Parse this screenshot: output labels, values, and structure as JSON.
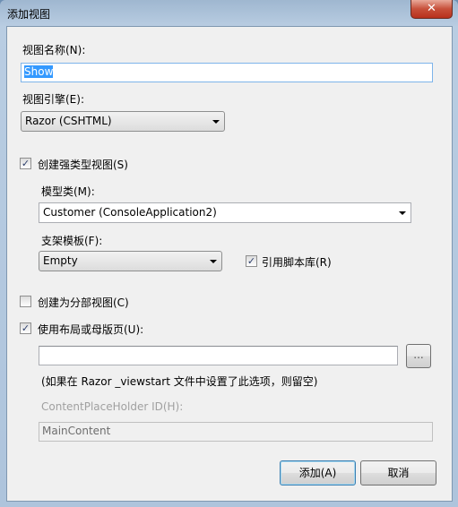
{
  "window": {
    "title": "添加视图",
    "close_icon": "close-icon"
  },
  "view_name": {
    "label": "视图名称(N):",
    "value": "Show"
  },
  "view_engine": {
    "label": "视图引擎(E):",
    "selected": "Razor (CSHTML)"
  },
  "strongly_typed": {
    "label": "创建强类型视图(S)",
    "checked": true
  },
  "model_class": {
    "label": "模型类(M):",
    "selected": "Customer (ConsoleApplication2)"
  },
  "scaffold_template": {
    "label": "支架模板(F):",
    "selected": "Empty"
  },
  "reference_scripts": {
    "label": "引用脚本库(R)",
    "checked": true
  },
  "partial_view": {
    "label": "创建为分部视图(C)",
    "checked": false
  },
  "use_layout": {
    "label": "使用布局或母版页(U):",
    "checked": true,
    "value": "",
    "browse_label": "...",
    "hint": "(如果在 Razor _viewstart 文件中设置了此选项，则留空)"
  },
  "placeholder_id": {
    "label": "ContentPlaceHolder ID(H):",
    "value": "MainContent"
  },
  "buttons": {
    "add": "添加(A)",
    "cancel": "取消"
  }
}
